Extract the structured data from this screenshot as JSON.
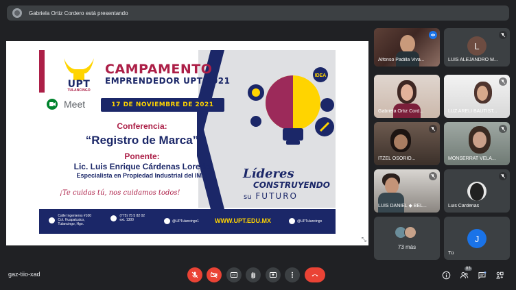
{
  "top_bar": {
    "presenting_text": "Gabriela Ortiz Cordero está presentando"
  },
  "slide": {
    "logo_text": "UPT",
    "logo_sub": "TULANCINGO",
    "title": "CAMPAMENTO",
    "subtitle": "EMPRENDEDOR UPT 2021",
    "meet_label": "Meet",
    "date": "17 DE NOVIEMBRE DE 2021",
    "conference_label": "Conferencia:",
    "conference_title": "“Registro de Marca”",
    "speaker_label": "Ponente:",
    "speaker_name": "Lic. Luis Enrique Cárdenas Loredo",
    "speaker_role": "Especialista en Propiedad Industrial del IMPI",
    "slogan": "¡Te cuidas tú, nos cuidamos todos!",
    "idea_label": "IDEA",
    "lideres": "Líderes",
    "construyendo": "CONSTRUYENDO",
    "su": "su",
    "futuro": "FUTURO",
    "footer": {
      "address_1": "Calle Ingenieros #100",
      "address_2": "Col. Huapalcalco,",
      "address_3": "Tulancingo, Hgo.",
      "phone_1": "(775) 75 5 82 02",
      "phone_2": "ext. 1300",
      "facebook": "@UPTulancingo1",
      "web": "WWW.UPT.EDU.MX",
      "twitter": "@UPTulancingo"
    }
  },
  "participants": [
    {
      "name": "Alfonso Padilla Viva...",
      "video": true
    },
    {
      "name": "LUIS ALEJANDRO M...",
      "initial": "L",
      "avatar_color": "#6d4c41"
    },
    {
      "name": "Gabriela Ortiz Cord...",
      "video": true
    },
    {
      "name": "LUZ ARELI BAUTIST...",
      "video": true
    },
    {
      "name": "ITZEL OSORIO...",
      "video": true
    },
    {
      "name": "MONSERRAT VELA...",
      "video": true
    },
    {
      "name": "LUIS DANIEL ◆ BEL...",
      "video": true
    },
    {
      "name": "Luis Cardenas",
      "video": false
    },
    {
      "name": "73 más",
      "video": false
    },
    {
      "name": "Tú",
      "initial": "J",
      "avatar_color": "#1a73e8"
    }
  ],
  "bottom_bar": {
    "meeting_code": "gaz-tiio-xad",
    "participant_count": "83"
  },
  "icons": [
    "mic-off-icon",
    "camera-off-icon",
    "captions-icon",
    "raise-hand-icon",
    "present-icon",
    "more-icon",
    "end-call-icon",
    "info-icon",
    "people-icon",
    "chat-icon",
    "activities-icon"
  ],
  "colors": {
    "end_call": "#ea4335",
    "upt_navy": "#1b2768",
    "upt_maroon": "#ac1f47",
    "upt_yellow": "#ffd400"
  }
}
